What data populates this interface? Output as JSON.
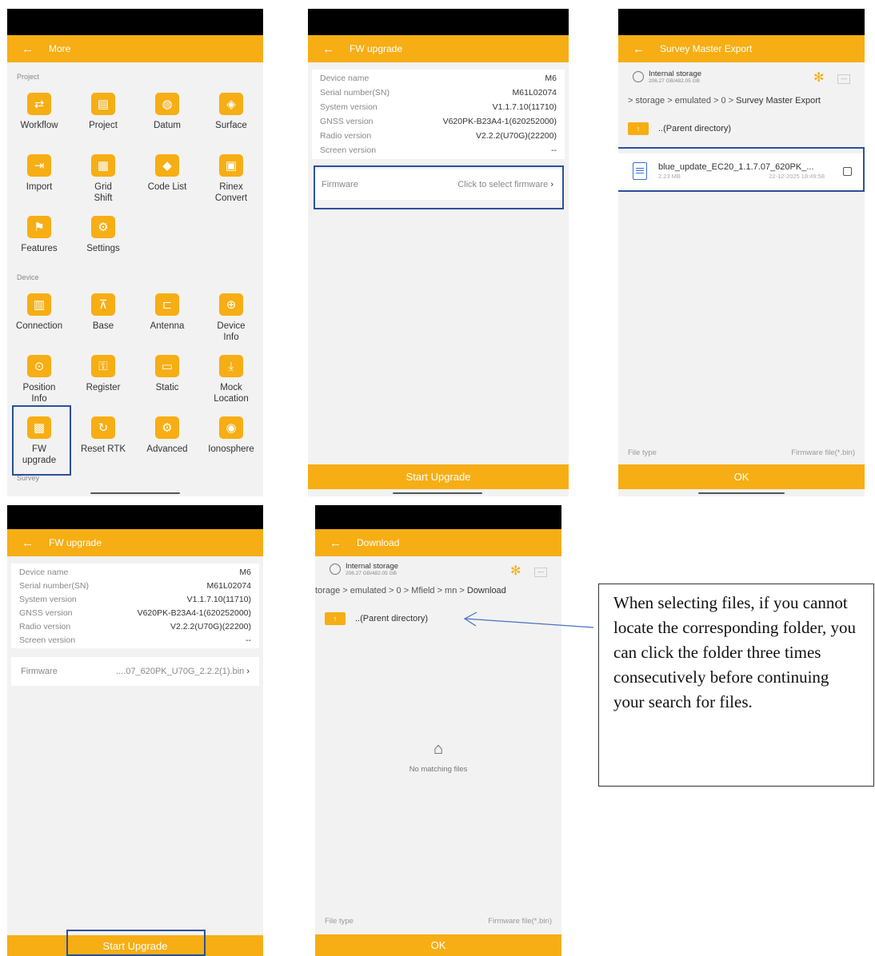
{
  "colors": {
    "accent": "#f6ae14",
    "highlight": "#2d4f9a",
    "bluetooth": "#f6ae14"
  },
  "panel_more": {
    "title": "More",
    "sections": [
      {
        "label": "Project",
        "items": [
          {
            "label": "Workflow",
            "icon": "workflow-icon"
          },
          {
            "label": "Project",
            "icon": "project-icon"
          },
          {
            "label": "Datum",
            "icon": "globe-icon"
          },
          {
            "label": "Surface",
            "icon": "surface-icon"
          },
          {
            "label": "Import",
            "icon": "import-icon"
          },
          {
            "label": "Grid\nShift",
            "icon": "grid-shift-icon"
          },
          {
            "label": "Code List",
            "icon": "tag-icon"
          },
          {
            "label": "Rinex\nConvert",
            "icon": "rinex-icon"
          },
          {
            "label": "Features",
            "icon": "features-icon"
          },
          {
            "label": "Settings",
            "icon": "gear-icon"
          }
        ]
      },
      {
        "label": "Device",
        "items": [
          {
            "label": "Connection",
            "icon": "connection-icon"
          },
          {
            "label": "Base",
            "icon": "base-icon"
          },
          {
            "label": "Antenna",
            "icon": "antenna-icon"
          },
          {
            "label": "Device\nInfo",
            "icon": "device-info-icon"
          },
          {
            "label": "Position\nInfo",
            "icon": "position-icon"
          },
          {
            "label": "Register",
            "icon": "key-icon"
          },
          {
            "label": "Static",
            "icon": "static-icon"
          },
          {
            "label": "Mock\nLocation",
            "icon": "mock-location-icon"
          },
          {
            "label": "FW\nupgrade",
            "icon": "chip-icon"
          },
          {
            "label": "Reset RTK",
            "icon": "reset-icon"
          },
          {
            "label": "Advanced",
            "icon": "advanced-gear-icon"
          },
          {
            "label": "Ionosphere",
            "icon": "signal-icon"
          }
        ]
      }
    ],
    "survey_label": "Survey"
  },
  "fw_upgrade": {
    "title": "FW upgrade",
    "rows": [
      {
        "k": "Device name",
        "v": "M6"
      },
      {
        "k": "Serial number(SN)",
        "v": "M61L02074"
      },
      {
        "k": "System version",
        "v": "V1.1.7.10(11710)"
      },
      {
        "k": "GNSS version",
        "v": "V620PK-B23A4-1(620252000)"
      },
      {
        "k": "Radio version",
        "v": "V2.2.2(U70G)(22200)"
      },
      {
        "k": "Screen version",
        "v": "--"
      }
    ],
    "firmware_label": "Firmware",
    "firmware_placeholder": "Click to select firmware",
    "firmware_selected": "....07_620PK_U70G_2.2.2(1).bin",
    "start_button": "Start Upgrade"
  },
  "export_browser": {
    "title": "Survey Master Export",
    "storage_title": "Internal storage",
    "storage_sub": "206.27 GB/482.05 GB",
    "path_prefix": "> storage > emulated > 0 > ",
    "path_current": "Survey Master Export",
    "parent_dir": "..(Parent directory)",
    "file_name": "blue_update_EC20_1.1.7.07_620PK_...",
    "file_size": "2.23 MB",
    "file_date": "22-12-2025 18:49:58",
    "file_type_label": "File type",
    "file_type_value": "Firmware file(*.bin)",
    "ok_button": "OK"
  },
  "download_browser": {
    "title": "Download",
    "storage_title": "Internal storage",
    "storage_sub": "206.27 GB/482.05 GB",
    "path_prefix": "torage > emulated > 0 > Mfield > mn > ",
    "path_current": "Download",
    "parent_dir": "..(Parent directory)",
    "empty_text": "No matching files",
    "file_type_label": "File type",
    "file_type_value": "Firmware file(*.bin)",
    "ok_button": "OK"
  },
  "note": "When selecting files, if you cannot locate the corresponding folder, you can click the folder three times consecutively before continuing your search for files."
}
